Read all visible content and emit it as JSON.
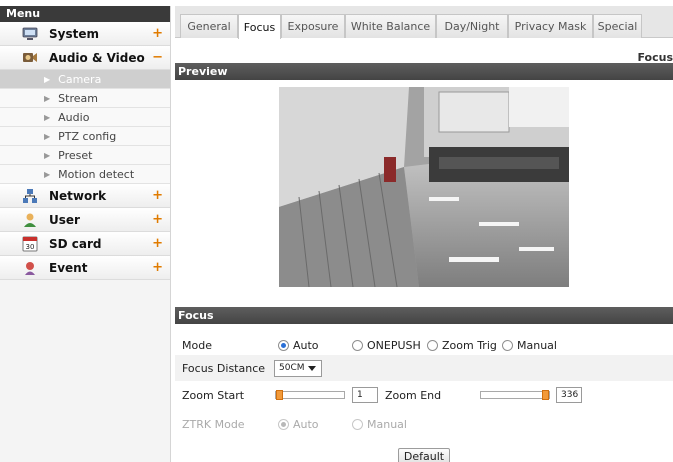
{
  "sidebar": {
    "header": "Menu",
    "items": [
      {
        "label": "System",
        "sign": "+",
        "icon": "system-icon"
      },
      {
        "label": "Audio & Video",
        "sign": "−",
        "icon": "audio-video-icon",
        "children": [
          "Camera",
          "Stream",
          "Audio",
          "PTZ config",
          "Preset",
          "Motion detect"
        ],
        "active_child": "Camera"
      },
      {
        "label": "Network",
        "sign": "+",
        "icon": "network-icon"
      },
      {
        "label": "User",
        "sign": "+",
        "icon": "user-icon"
      },
      {
        "label": "SD card",
        "sign": "+",
        "icon": "sd-card-icon",
        "icon_text": "30"
      },
      {
        "label": "Event",
        "sign": "+",
        "icon": "event-icon"
      }
    ]
  },
  "tabs": [
    "General",
    "Focus",
    "Exposure",
    "White Balance",
    "Day/Night",
    "Privacy Mask",
    "Special"
  ],
  "active_tab": "Focus",
  "page_label": "Focus",
  "preview": {
    "title": "Preview"
  },
  "focus": {
    "title": "Focus",
    "mode": {
      "label": "Mode",
      "options": [
        "Auto",
        "ONEPUSH",
        "Zoom Trig",
        "Manual"
      ],
      "selected": "Auto"
    },
    "focus_distance": {
      "label": "Focus Distance",
      "value": "50CM"
    },
    "zoom_start": {
      "label": "Zoom Start",
      "value": "1",
      "slider_fraction": 0.0
    },
    "zoom_end": {
      "label": "Zoom End",
      "value": "336",
      "slider_fraction": 1.0
    },
    "ztrk_mode": {
      "label": "ZTRK Mode",
      "options": [
        "Auto",
        "Manual"
      ],
      "selected": "Auto",
      "disabled": true
    },
    "default_button": "Default"
  },
  "colors": {
    "accent": "#e07b00",
    "section_bar": "#4d4d4d",
    "slider_thumb": "#f29a3a",
    "radio_on": "#2a6fd6"
  }
}
